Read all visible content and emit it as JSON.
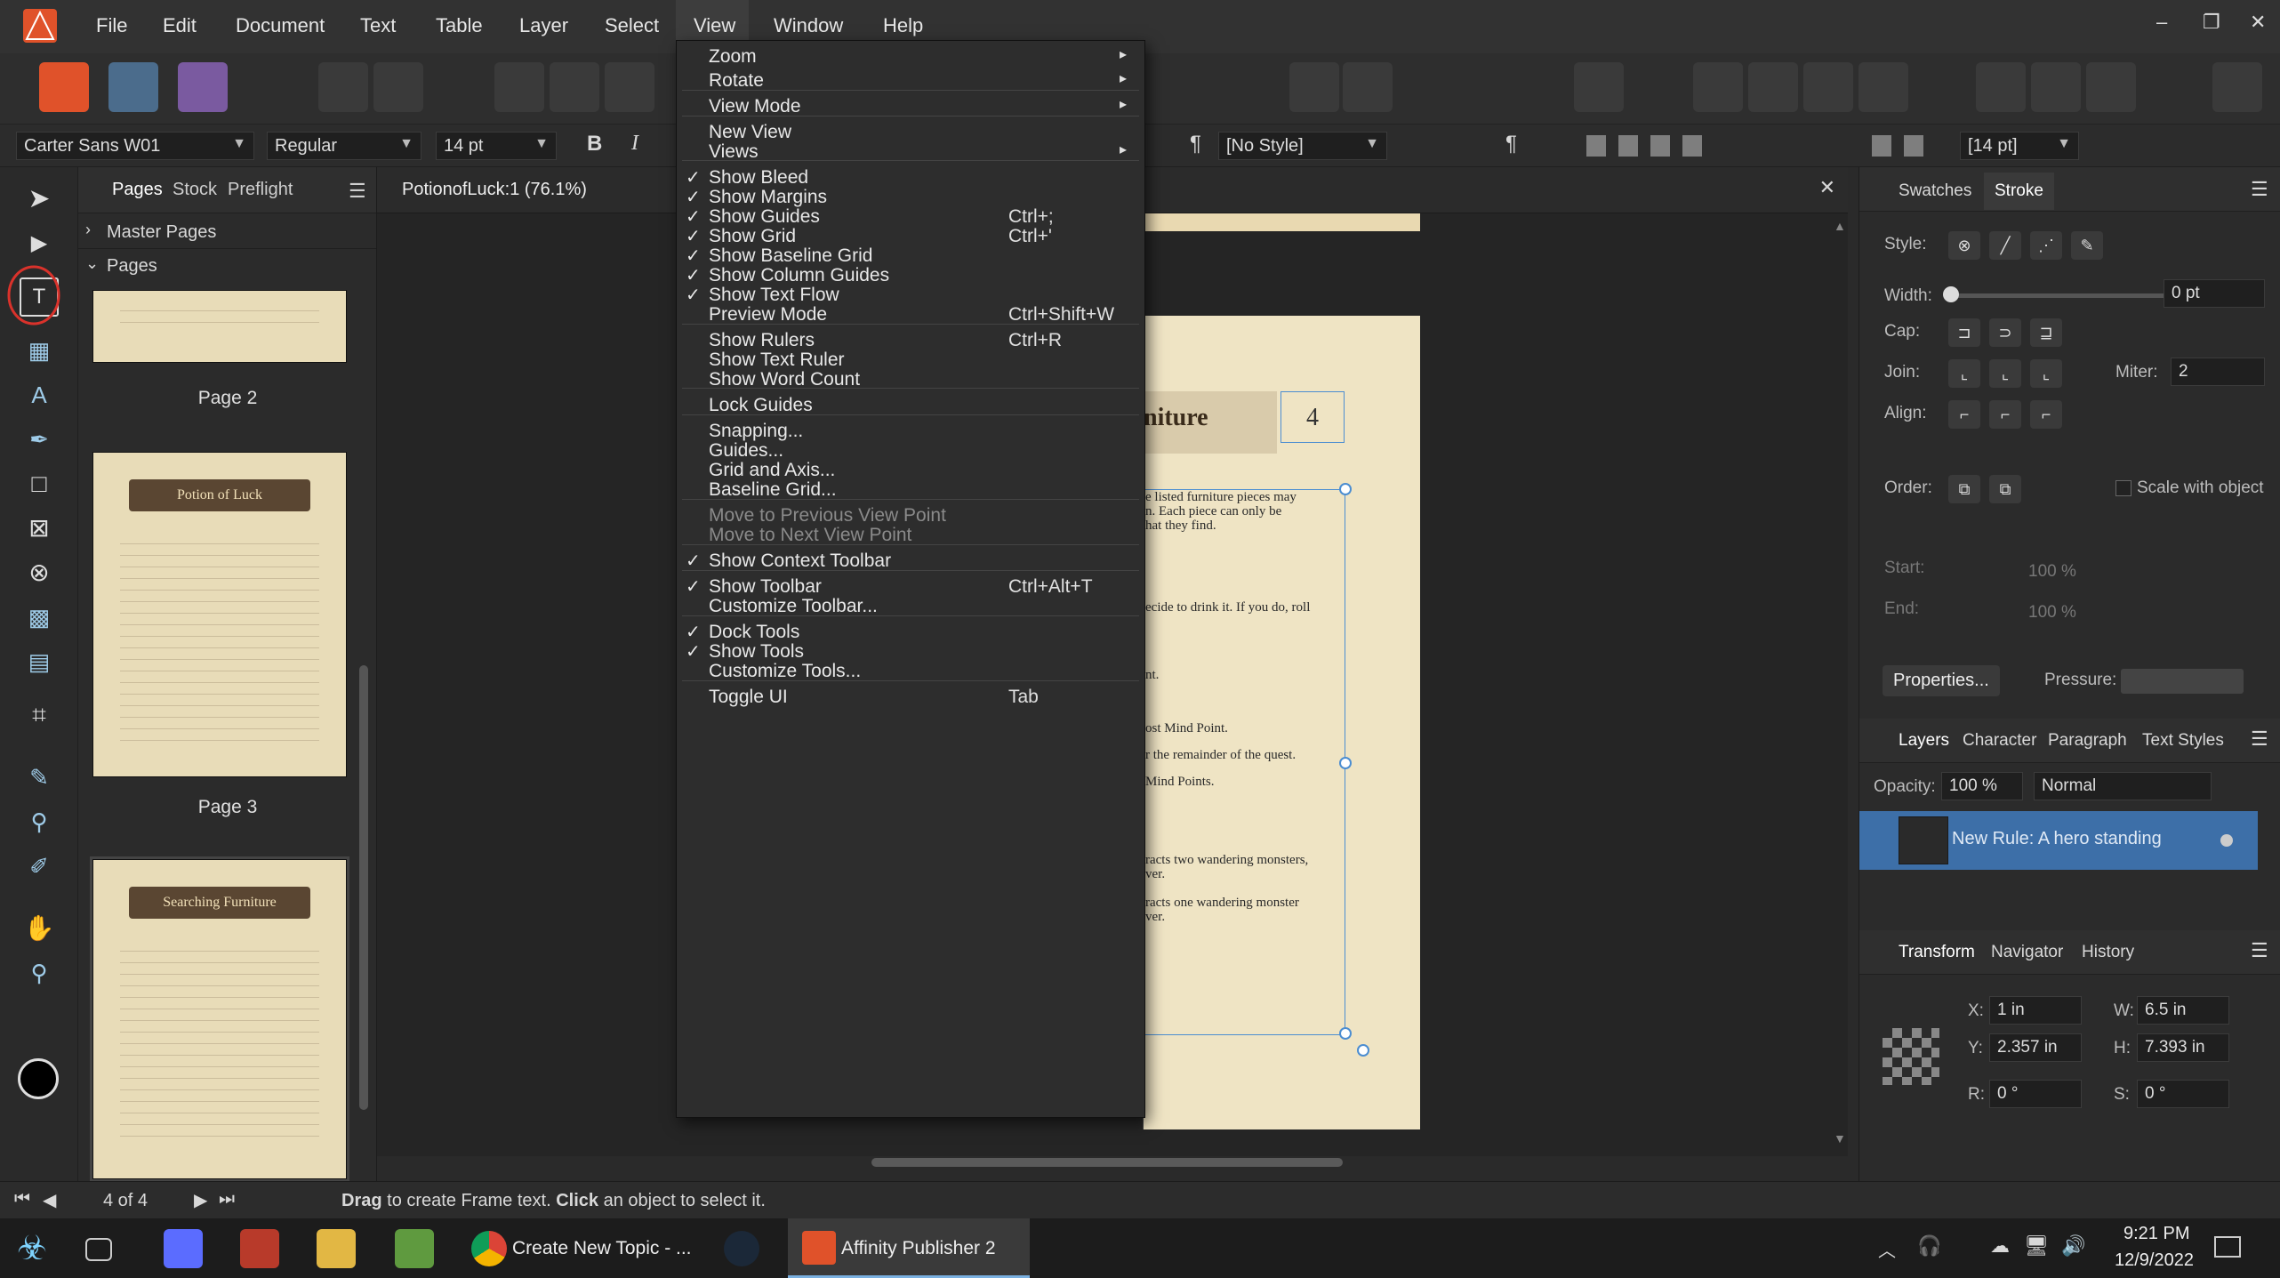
{
  "menubar": {
    "items": [
      "File",
      "Edit",
      "Document",
      "Text",
      "Table",
      "Layer",
      "Select",
      "View",
      "Window",
      "Help"
    ],
    "window_controls": [
      "–",
      "❐",
      "✕"
    ]
  },
  "context_toolbar": {
    "font_family": "Carter Sans W01",
    "font_style": "Regular",
    "font_size": "14 pt",
    "bold": "B",
    "italic": "I",
    "pilcrow": "¶",
    "para_style": "[No Style]",
    "pilcrow2": "¶",
    "size2": "[14 pt]"
  },
  "left_panel": {
    "tabs": [
      "Pages",
      "Stock",
      "Preflight"
    ],
    "master_pages": "Master Pages",
    "pages": "Pages",
    "thumbnails": [
      {
        "label": "Page 2",
        "title": ""
      },
      {
        "label": "Page 3",
        "title": "Potion of Luck",
        "number": "3"
      },
      {
        "label": "",
        "title": "Searching Furniture",
        "number": "4"
      }
    ]
  },
  "document": {
    "tab_title": "PotionofLuck:1 (76.1%)",
    "banner_text": "niture",
    "page_number": "4",
    "text_lines": [
      "e listed furniture pieces may",
      "n. Each piece can only be",
      "hat they find.",
      "ecide to drink it. If you do, roll",
      "nt.",
      "ost Mind Point.",
      "r the remainder of the quest.",
      "Mind Points.",
      "racts two wandering monsters,",
      "ver.",
      "racts one wandering monster",
      "ver."
    ]
  },
  "view_menu": {
    "items": [
      {
        "label": "Zoom",
        "submenu": true
      },
      {
        "label": "Rotate",
        "submenu": true
      },
      {
        "label": "View Mode",
        "submenu": true
      },
      {
        "label": "New View"
      },
      {
        "label": "Views",
        "submenu": true
      },
      {
        "label": "Show Bleed",
        "checked": true
      },
      {
        "label": "Show Margins",
        "checked": true
      },
      {
        "label": "Show Guides",
        "checked": true,
        "shortcut": "Ctrl+;"
      },
      {
        "label": "Show Grid",
        "checked": true,
        "shortcut": "Ctrl+'"
      },
      {
        "label": "Show Baseline Grid",
        "checked": true
      },
      {
        "label": "Show Column Guides",
        "checked": true
      },
      {
        "label": "Show Text Flow",
        "checked": true
      },
      {
        "label": "Preview Mode",
        "shortcut": "Ctrl+Shift+W"
      },
      {
        "label": "Show Rulers",
        "shortcut": "Ctrl+R"
      },
      {
        "label": "Show Text Ruler"
      },
      {
        "label": "Show Word Count"
      },
      {
        "label": "Lock Guides"
      },
      {
        "label": "Snapping..."
      },
      {
        "label": "Guides..."
      },
      {
        "label": "Grid and Axis..."
      },
      {
        "label": "Baseline Grid..."
      },
      {
        "label": "Move to Previous View Point",
        "disabled": true
      },
      {
        "label": "Move to Next View Point",
        "disabled": true
      },
      {
        "label": "Show Context Toolbar",
        "checked": true
      },
      {
        "label": "Show Toolbar",
        "checked": true,
        "shortcut": "Ctrl+Alt+T"
      },
      {
        "label": "Customize Toolbar..."
      },
      {
        "label": "Dock Tools",
        "checked": true
      },
      {
        "label": "Show Tools",
        "checked": true
      },
      {
        "label": "Customize Tools..."
      },
      {
        "label": "Toggle UI",
        "shortcut": "Tab"
      }
    ],
    "check_glyph": "✓",
    "submenu_glyph": "▸"
  },
  "right_panel": {
    "top_tabs": [
      "Swatches",
      "Stroke"
    ],
    "style_label": "Style:",
    "width_label": "Width:",
    "width_value": "0 pt",
    "cap_label": "Cap:",
    "join_label": "Join:",
    "miter_label": "Miter:",
    "miter_value": "2",
    "align_label": "Align:",
    "order_label": "Order:",
    "scale_with_object": "Scale with object",
    "start_label": "Start:",
    "end_label": "End:",
    "start_pct": "100 %",
    "end_pct": "100 %",
    "properties_button": "Properties...",
    "pressure_label": "Pressure:",
    "layer_tabs": [
      "Layers",
      "Character",
      "Paragraph",
      "Text Styles"
    ],
    "opacity_label": "Opacity:",
    "opacity_value": "100 %",
    "blend_mode": "Normal",
    "layer_name": "New Rule: A hero standing",
    "transform_tabs": [
      "Transform",
      "Navigator",
      "History"
    ],
    "x_label": "X:",
    "x_value": "1 in",
    "y_label": "Y:",
    "y_value": "2.357 in",
    "w_label": "W:",
    "w_value": "6.5 in",
    "h_label": "H:",
    "h_value": "7.393 in",
    "r_label": "R:",
    "r_value": "0 °",
    "s_label": "S:",
    "s_value": "0 °"
  },
  "statusbar": {
    "page_indicator": "4 of 4",
    "hint_drag": "Drag",
    "hint_mid": " to create Frame text. ",
    "hint_click": "Click",
    "hint_end": " an object to select it."
  },
  "taskbar": {
    "chrome_label": "Create New Topic - ...",
    "affinity_label": "Affinity Publisher 2",
    "time": "9:21 PM",
    "date": "12/9/2022"
  },
  "colors": {
    "accent_blue": "#4b8dd1",
    "affinity_red": "#e0522a",
    "selection_layer": "#3d6fa8",
    "annotation_red": "#d9322b"
  }
}
